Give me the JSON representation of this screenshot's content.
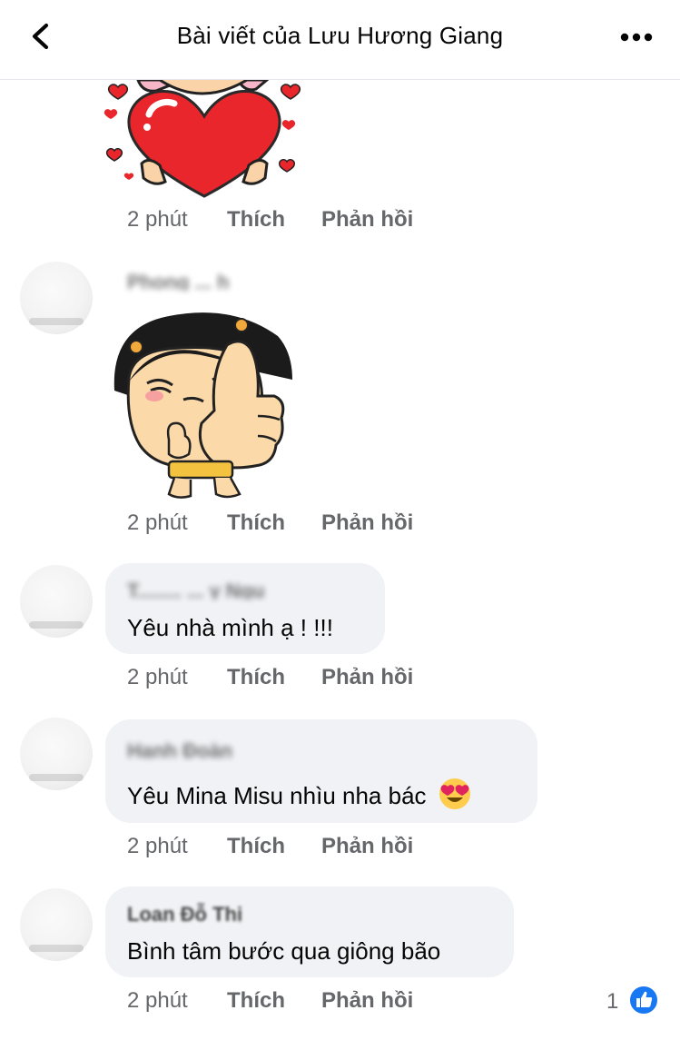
{
  "header": {
    "title": "Bài viết của Lưu Hương Giang",
    "back_icon": "chevron-left-icon",
    "more_icon": "more-horizontal-icon"
  },
  "comments": [
    {
      "type": "sticker",
      "sticker": "heart-sticker",
      "actions": {
        "time": "2 phút",
        "like": "Thích",
        "reply": "Phản hồi"
      }
    },
    {
      "type": "sticker",
      "author": "Phong ... h",
      "sticker": "thumbs-up-girl-sticker",
      "actions": {
        "time": "2 phút",
        "like": "Thích",
        "reply": "Phản hồi"
      }
    },
    {
      "type": "text",
      "author": "T........ ... y Ngu",
      "text": "Yêu nhà mình ạ ! !!!",
      "actions": {
        "time": "2 phút",
        "like": "Thích",
        "reply": "Phản hồi"
      }
    },
    {
      "type": "text",
      "author": "Hạnh Đoàn",
      "text": "Yêu Mina Misu nhìu nha bác",
      "emoji": "heart-eyes-emoji",
      "actions": {
        "time": "2 phút",
        "like": "Thích",
        "reply": "Phản hồi"
      }
    },
    {
      "type": "text",
      "author": "Loan Đỗ Thị",
      "text": "Bình tâm bước qua giông bão",
      "actions": {
        "time": "2 phút",
        "like": "Thích",
        "reply": "Phản hồi"
      },
      "reaction": {
        "icon": "like-icon",
        "count": "1"
      }
    }
  ],
  "colors": {
    "bubble": "#f0f2f5",
    "meta_text": "#65676b",
    "like_blue": "#1877f2",
    "text": "#050505"
  }
}
